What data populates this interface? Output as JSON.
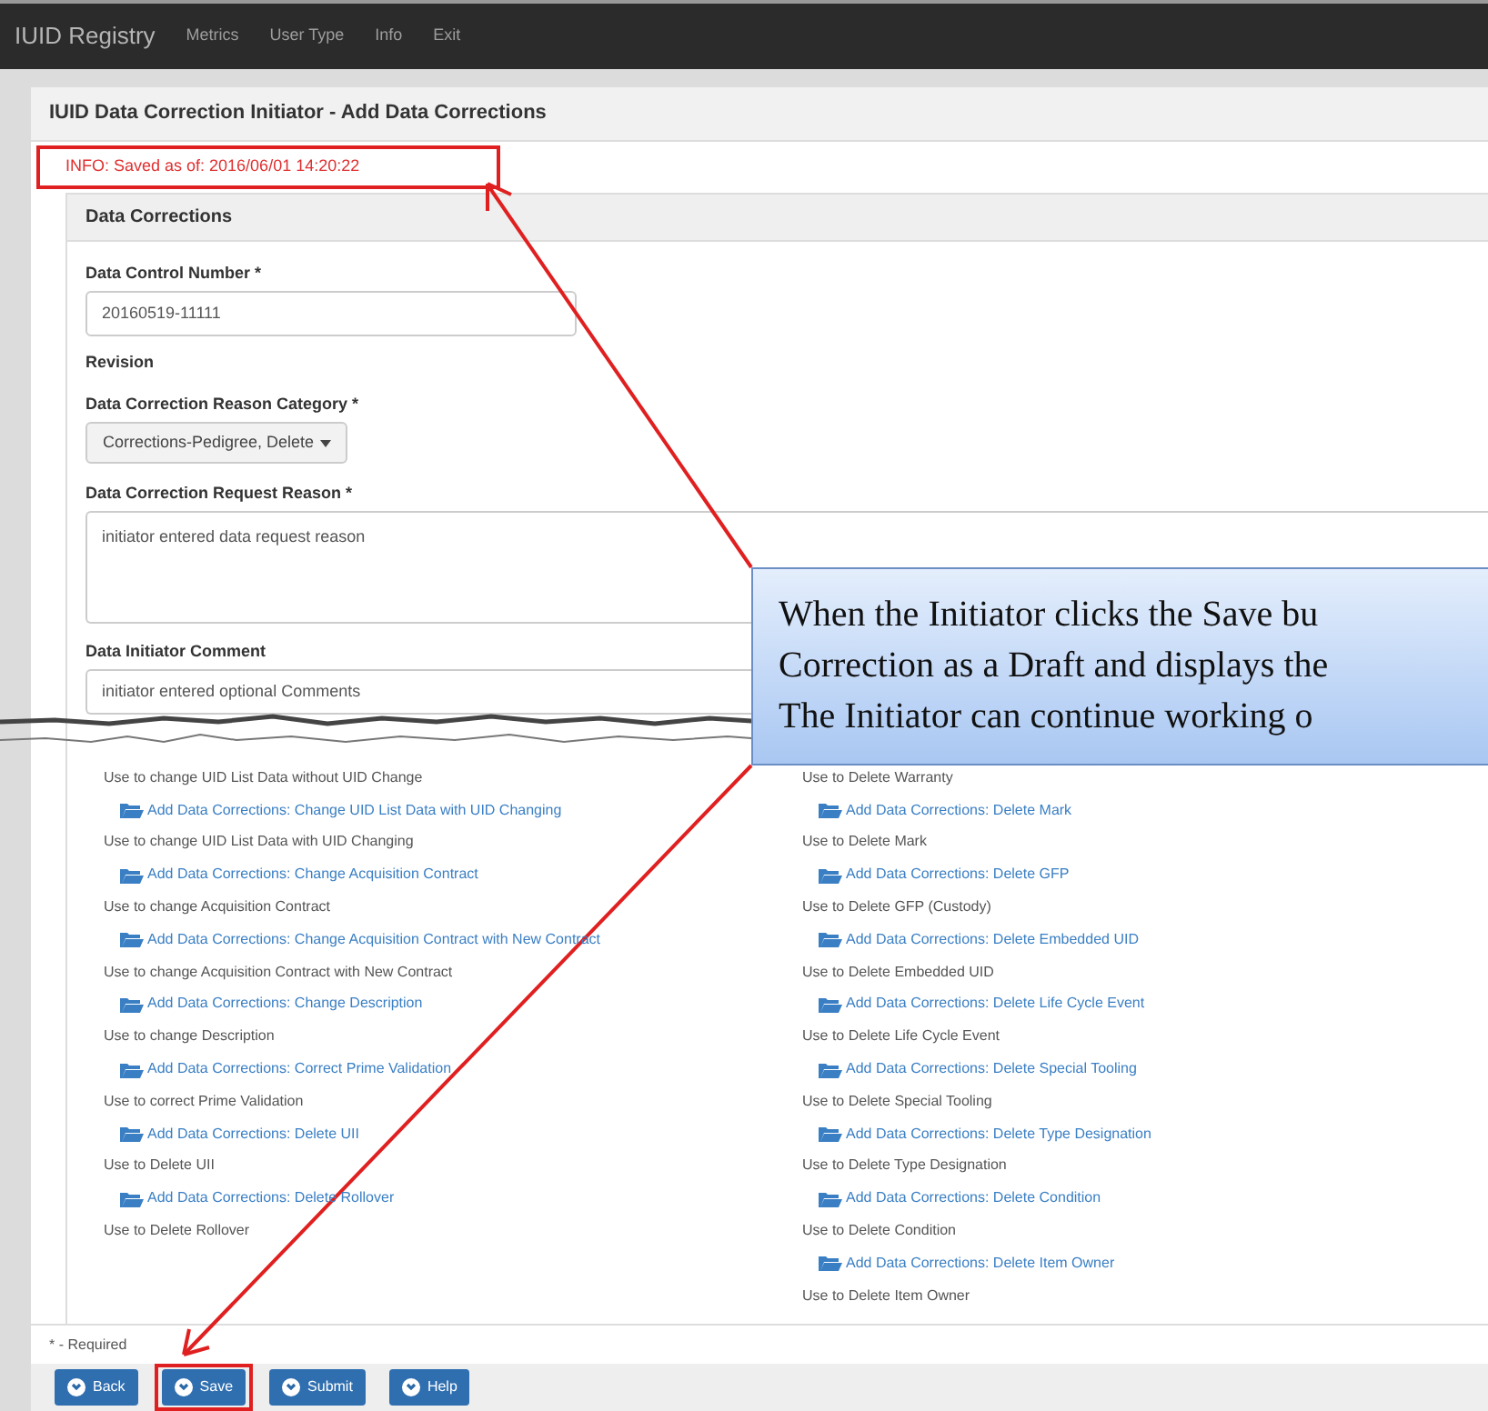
{
  "navbar": {
    "brand": "IUID Registry",
    "items": [
      "Metrics",
      "User Type",
      "Info",
      "Exit"
    ]
  },
  "page_title": "IUID Data Correction Initiator - Add Data Corrections",
  "info": {
    "text": "INFO: Saved as of: 2016/06/01 14:20:22",
    "highlighted": true
  },
  "section_title": "Data Corrections",
  "fields": [
    {
      "kind": "input",
      "label": "Data Control Number *",
      "value": "20160519-11111"
    },
    {
      "kind": "heading",
      "label": "Revision"
    },
    {
      "kind": "dropdown",
      "label": "Data Correction Reason Category *",
      "value": "Corrections-Pedigree, Delete"
    },
    {
      "kind": "textarea",
      "label": "Data Correction Request Reason *",
      "value": "initiator entered data request reason"
    },
    {
      "kind": "input",
      "label": "Data Initiator Comment",
      "value": "initiator entered optional Comments"
    }
  ],
  "corrections_left": [
    {
      "kind": "description",
      "text": "Use to change UID List Data without UID Change"
    },
    {
      "kind": "link",
      "text": "Add Data Corrections: Change UID List Data with UID Changing"
    },
    {
      "kind": "description",
      "text": "Use to change UID List Data with UID Changing"
    },
    {
      "kind": "link",
      "text": "Add Data Corrections: Change Acquisition Contract"
    },
    {
      "kind": "description",
      "text": "Use to change Acquisition Contract"
    },
    {
      "kind": "link",
      "text": "Add Data Corrections: Change Acquisition Contract with New Contract"
    },
    {
      "kind": "description",
      "text": "Use to change Acquisition Contract with New Contract"
    },
    {
      "kind": "link",
      "text": "Add Data Corrections: Change Description"
    },
    {
      "kind": "description",
      "text": "Use to change Description"
    },
    {
      "kind": "link",
      "text": "Add Data Corrections: Correct Prime Validation"
    },
    {
      "kind": "description",
      "text": "Use to correct Prime Validation"
    },
    {
      "kind": "link",
      "text": "Add Data Corrections: Delete UII"
    },
    {
      "kind": "description",
      "text": "Use to Delete UII"
    },
    {
      "kind": "link",
      "text": "Add Data Corrections: Delete Rollover"
    },
    {
      "kind": "description",
      "text": "Use to Delete Rollover"
    }
  ],
  "corrections_right": [
    {
      "kind": "description",
      "text": "Use to Delete Warranty"
    },
    {
      "kind": "link",
      "text": "Add Data Corrections: Delete Mark"
    },
    {
      "kind": "description",
      "text": "Use to Delete Mark"
    },
    {
      "kind": "link",
      "text": "Add Data Corrections: Delete GFP"
    },
    {
      "kind": "description",
      "text": "Use to Delete GFP (Custody)"
    },
    {
      "kind": "link",
      "text": "Add Data Corrections: Delete Embedded UID"
    },
    {
      "kind": "description",
      "text": "Use to Delete Embedded UID"
    },
    {
      "kind": "link",
      "text": "Add Data Corrections: Delete Life Cycle Event"
    },
    {
      "kind": "description",
      "text": "Use to Delete Life Cycle Event"
    },
    {
      "kind": "link",
      "text": "Add Data Corrections: Delete Special Tooling"
    },
    {
      "kind": "description",
      "text": "Use to Delete Special Tooling"
    },
    {
      "kind": "link",
      "text": "Add Data Corrections: Delete Type Designation"
    },
    {
      "kind": "description",
      "text": "Use to Delete Type Designation"
    },
    {
      "kind": "link",
      "text": "Add Data Corrections: Delete Condition"
    },
    {
      "kind": "description",
      "text": "Use to Delete Condition"
    },
    {
      "kind": "link",
      "text": "Add Data Corrections: Delete Item Owner"
    },
    {
      "kind": "description",
      "text": "Use to Delete Item Owner"
    }
  ],
  "required_note": "* - Required",
  "buttons": [
    {
      "label": "Back",
      "highlighted": false
    },
    {
      "label": "Save",
      "highlighted": true
    },
    {
      "label": "Submit",
      "highlighted": false
    },
    {
      "label": "Help",
      "highlighted": false
    }
  ],
  "callout": {
    "lines": [
      "When the Initiator clicks the Save bu",
      "Correction as a Draft and displays the",
      "The Initiator can continue working o"
    ]
  }
}
